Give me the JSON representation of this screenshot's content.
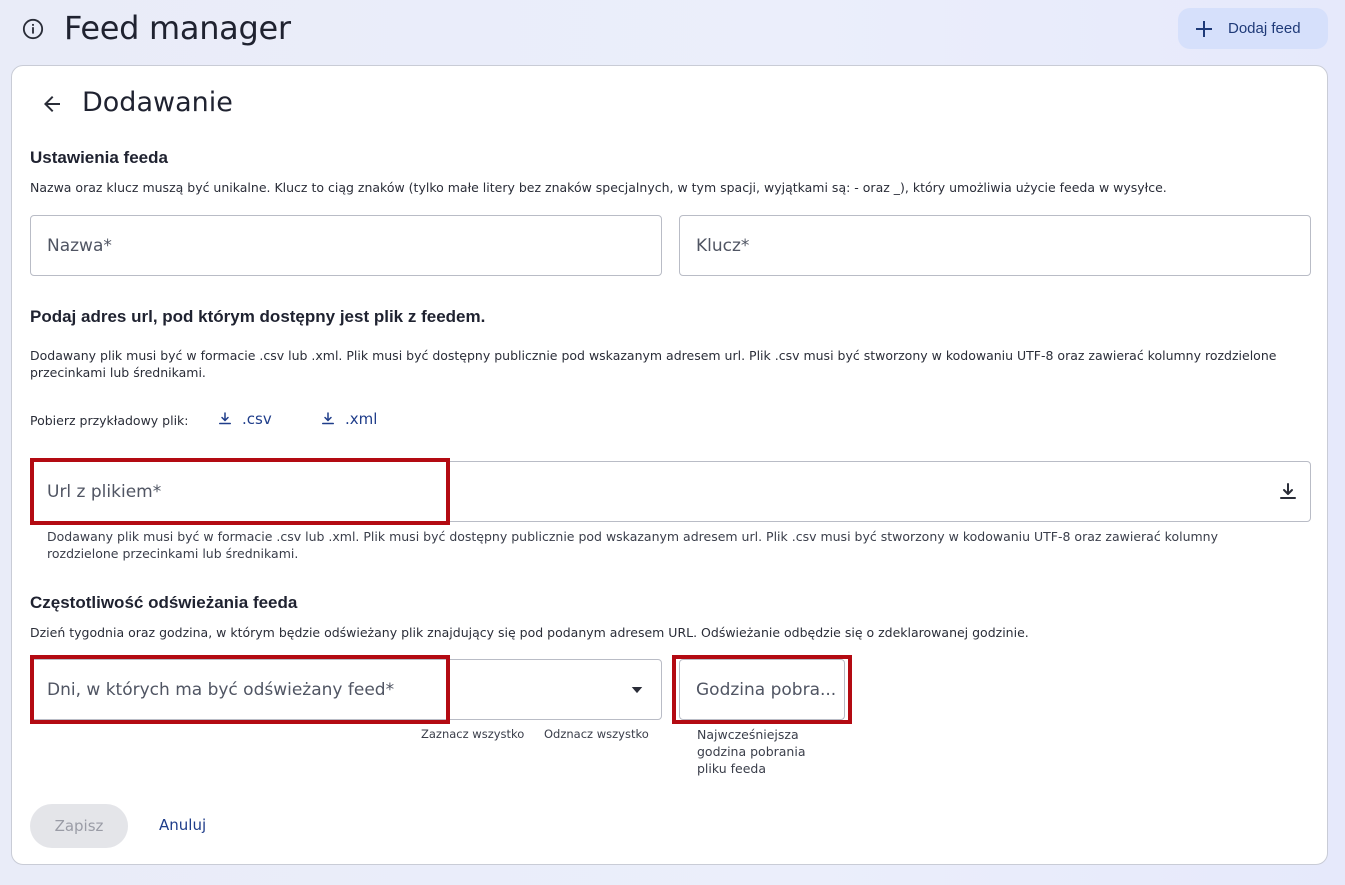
{
  "header": {
    "title": "Feed manager",
    "add_button_label": "Dodaj feed"
  },
  "form": {
    "title": "Dodawanie",
    "settings": {
      "heading": "Ustawienia feeda",
      "description": "Nazwa oraz klucz muszą być unikalne. Klucz to ciąg znaków (tylko małe litery bez znaków specjalnych, w tym spacji, wyjątkami są: - oraz _), który umożliwia użycie feeda w wysyłce.",
      "name_placeholder": "Nazwa*",
      "key_placeholder": "Klucz*"
    },
    "url_section": {
      "heading": "Podaj adres url, pod którym dostępny jest plik z feedem.",
      "description": "Dodawany plik musi być w formacie .csv lub .xml. Plik musi być dostępny publicznie pod wskazanym adresem url. Plik .csv musi być stworzony w kodowaniu UTF-8 oraz zawierać kolumny rozdzielone przecinkami lub średnikami.",
      "sample_label": "Pobierz przykładowy plik:",
      "sample_csv": ".csv",
      "sample_xml": ".xml",
      "url_placeholder": "Url z plikiem*",
      "url_helper": "Dodawany plik musi być w formacie .csv lub .xml. Plik musi być dostępny publicznie pod wskazanym adresem url. Plik .csv musi być stworzony w kodowaniu UTF-8 oraz zawierać kolumny rozdzielone przecinkami lub średnikami."
    },
    "frequency": {
      "heading": "Częstotliwość odświeżania feeda",
      "description": "Dzień tygodnia oraz godzina, w którym będzie odświeżany plik znajdujący się pod podanym adresem URL. Odświeżanie odbędzie się o zdeklarowanej godzinie.",
      "days_placeholder": "Dni, w których ma być odświeżany feed*",
      "select_all": "Zaznacz wszystko",
      "deselect_all": "Odznacz wszystko",
      "hour_placeholder": "Godzina pobra...",
      "hour_helper": "Najwcześniejsza godzina pobrania pliku feeda"
    },
    "save_label": "Zapisz",
    "cancel_label": "Anuluj"
  },
  "colors": {
    "highlight": "#b30a12",
    "link": "#1f3d8a",
    "add_button_bg": "#d6e0fb"
  }
}
